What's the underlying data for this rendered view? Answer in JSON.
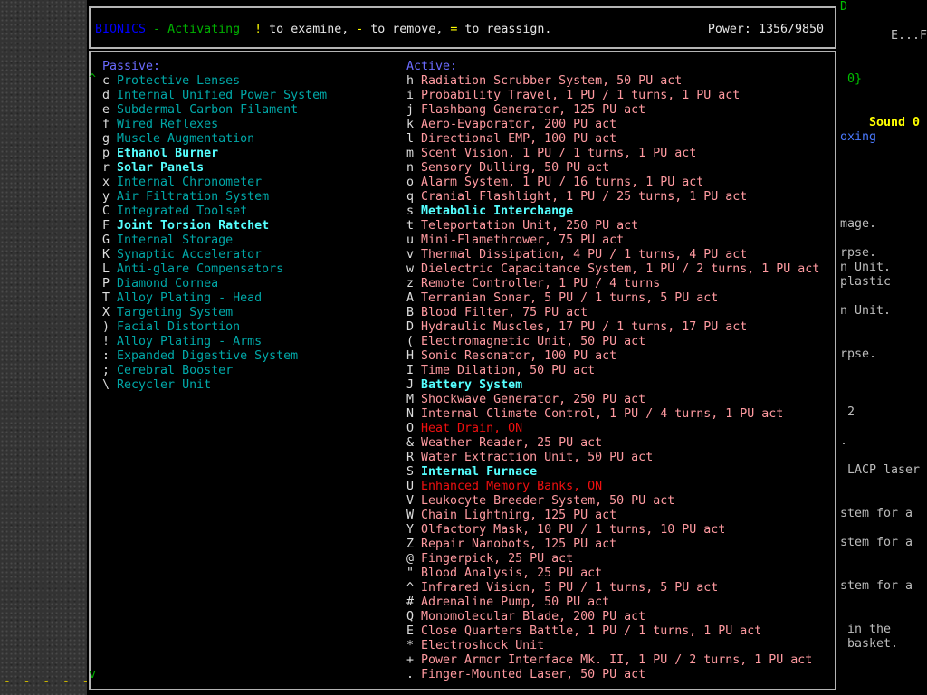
{
  "header": {
    "title": "BIONICS",
    "sep": " - ",
    "mode": "Activating",
    "k_examine": "!",
    "t_examine": " to examine, ",
    "k_remove": "-",
    "t_remove": " to remove, ",
    "k_reassign": "=",
    "t_reassign": " to reassign.",
    "power": "Power: 1356/9850"
  },
  "scroll": {
    "up": "^",
    "down": "v"
  },
  "passive": {
    "heading": "Passive:",
    "items": [
      {
        "key": "c",
        "name": "Protective Lenses",
        "hi": false
      },
      {
        "key": "d",
        "name": "Internal Unified Power System",
        "hi": false
      },
      {
        "key": "e",
        "name": "Subdermal Carbon Filament",
        "hi": false
      },
      {
        "key": "f",
        "name": "Wired Reflexes",
        "hi": false
      },
      {
        "key": "g",
        "name": "Muscle Augmentation",
        "hi": false
      },
      {
        "key": "p",
        "name": "Ethanol Burner",
        "hi": true
      },
      {
        "key": "r",
        "name": "Solar Panels",
        "hi": true
      },
      {
        "key": "x",
        "name": "Internal Chronometer",
        "hi": false
      },
      {
        "key": "y",
        "name": "Air Filtration System",
        "hi": false
      },
      {
        "key": "C",
        "name": "Integrated Toolset",
        "hi": false
      },
      {
        "key": "F",
        "name": "Joint Torsion Ratchet",
        "hi": true
      },
      {
        "key": "G",
        "name": "Internal Storage",
        "hi": false
      },
      {
        "key": "K",
        "name": "Synaptic Accelerator",
        "hi": false
      },
      {
        "key": "L",
        "name": "Anti-glare Compensators",
        "hi": false
      },
      {
        "key": "P",
        "name": "Diamond Cornea",
        "hi": false
      },
      {
        "key": "T",
        "name": "Alloy Plating - Head",
        "hi": false
      },
      {
        "key": "X",
        "name": "Targeting System",
        "hi": false
      },
      {
        "key": ")",
        "name": "Facial Distortion",
        "hi": false
      },
      {
        "key": "!",
        "name": "Alloy Plating - Arms",
        "hi": false
      },
      {
        "key": ":",
        "name": "Expanded Digestive System",
        "hi": false
      },
      {
        "key": ";",
        "name": "Cerebral Booster",
        "hi": false
      },
      {
        "key": "\\",
        "name": "Recycler Unit",
        "hi": false
      }
    ]
  },
  "active": {
    "heading": "Active:",
    "items": [
      {
        "key": "h",
        "name": "Radiation Scrubber System, 50 PU act",
        "state": "normal"
      },
      {
        "key": "i",
        "name": "Probability Travel, 1 PU / 1 turns, 1 PU act",
        "state": "normal"
      },
      {
        "key": "j",
        "name": "Flashbang Generator, 125 PU act",
        "state": "normal"
      },
      {
        "key": "k",
        "name": "Aero-Evaporator, 200 PU act",
        "state": "normal"
      },
      {
        "key": "l",
        "name": "Directional EMP, 100 PU act",
        "state": "normal"
      },
      {
        "key": "m",
        "name": "Scent Vision, 1 PU / 1 turns, 1 PU act",
        "state": "normal"
      },
      {
        "key": "n",
        "name": "Sensory Dulling, 50 PU act",
        "state": "normal"
      },
      {
        "key": "o",
        "name": "Alarm System, 1 PU / 16 turns, 1 PU act",
        "state": "normal"
      },
      {
        "key": "q",
        "name": "Cranial Flashlight, 1 PU / 25 turns, 1 PU act",
        "state": "normal"
      },
      {
        "key": "s",
        "name": "Metabolic Interchange",
        "state": "hi"
      },
      {
        "key": "t",
        "name": "Teleportation Unit, 250 PU act",
        "state": "normal"
      },
      {
        "key": "u",
        "name": "Mini-Flamethrower, 75 PU act",
        "state": "normal"
      },
      {
        "key": "v",
        "name": "Thermal Dissipation, 4 PU / 1 turns, 4 PU act",
        "state": "normal"
      },
      {
        "key": "w",
        "name": "Dielectric Capacitance System, 1 PU / 2 turns, 1 PU act",
        "state": "normal"
      },
      {
        "key": "z",
        "name": "Remote Controller, 1 PU / 4 turns",
        "state": "normal"
      },
      {
        "key": "A",
        "name": "Terranian Sonar, 5 PU / 1 turns, 5 PU act",
        "state": "normal"
      },
      {
        "key": "B",
        "name": "Blood Filter, 75 PU act",
        "state": "normal"
      },
      {
        "key": "D",
        "name": "Hydraulic Muscles, 17 PU / 1 turns, 17 PU act",
        "state": "normal"
      },
      {
        "key": "(",
        "name": "Electromagnetic Unit, 50 PU act",
        "state": "normal"
      },
      {
        "key": "H",
        "name": "Sonic Resonator, 100 PU act",
        "state": "normal"
      },
      {
        "key": "I",
        "name": "Time Dilation, 50 PU act",
        "state": "normal"
      },
      {
        "key": "J",
        "name": "Battery System",
        "state": "hi"
      },
      {
        "key": "M",
        "name": "Shockwave Generator, 250 PU act",
        "state": "normal"
      },
      {
        "key": "N",
        "name": "Internal Climate Control, 1 PU / 4 turns, 1 PU act",
        "state": "normal"
      },
      {
        "key": "O",
        "name": "Heat Drain, ON",
        "state": "on"
      },
      {
        "key": "&",
        "name": "Weather Reader, 25 PU act",
        "state": "normal"
      },
      {
        "key": "R",
        "name": "Water Extraction Unit, 50 PU act",
        "state": "normal"
      },
      {
        "key": "S",
        "name": "Internal Furnace",
        "state": "hi"
      },
      {
        "key": "U",
        "name": "Enhanced Memory Banks, ON",
        "state": "on"
      },
      {
        "key": "V",
        "name": "Leukocyte Breeder System, 50 PU act",
        "state": "normal"
      },
      {
        "key": "W",
        "name": "Chain Lightning, 125 PU act",
        "state": "normal"
      },
      {
        "key": "Y",
        "name": "Olfactory Mask, 10 PU / 1 turns, 10 PU act",
        "state": "normal"
      },
      {
        "key": "Z",
        "name": "Repair Nanobots, 125 PU act",
        "state": "normal"
      },
      {
        "key": "@",
        "name": "Fingerpick, 25 PU act",
        "state": "normal"
      },
      {
        "key": "\"",
        "name": "Blood Analysis, 25 PU act",
        "state": "normal"
      },
      {
        "key": "^",
        "name": "Infrared Vision, 5 PU / 1 turns, 5 PU act",
        "state": "normal"
      },
      {
        "key": "#",
        "name": "Adrenaline Pump, 50 PU act",
        "state": "normal"
      },
      {
        "key": "Q",
        "name": "Monomolecular Blade, 200 PU act",
        "state": "normal"
      },
      {
        "key": "E",
        "name": "Close Quarters Battle, 1 PU / 1 turns, 1 PU act",
        "state": "normal"
      },
      {
        "key": "*",
        "name": "Electroshock Unit",
        "state": "normal"
      },
      {
        "key": "+",
        "name": "Power Armor Interface Mk. II, 1 PU / 2 turns, 1 PU act",
        "state": "normal"
      },
      {
        "key": ".",
        "name": "Finger-Mounted Laser, 50 PU act",
        "state": "normal"
      }
    ]
  },
  "background": {
    "left_dashes": "- - - - -",
    "fragments": [
      {
        "text": "D",
        "color": "#00c000"
      },
      {
        "text": "E...F",
        "color": "#c0c0c0"
      },
      {
        "text": "0}",
        "color": "#00c000"
      },
      {
        "text": "Sound 0",
        "color": "#ffff00"
      },
      {
        "text": "oxing",
        "color": "#4a7aff"
      },
      {
        "text": "mage.",
        "color": "#bcbcbc"
      },
      {
        "text": "rpse.",
        "color": "#bcbcbc"
      },
      {
        "text": "n Unit.",
        "color": "#bcbcbc"
      },
      {
        "text": "plastic",
        "color": "#bcbcbc"
      },
      {
        "text": "n Unit.",
        "color": "#bcbcbc"
      },
      {
        "text": "rpse.",
        "color": "#bcbcbc"
      },
      {
        "text": "2",
        "color": "#bcbcbc"
      },
      {
        "text": ".",
        "color": "#bcbcbc"
      },
      {
        "text": "LACP laser",
        "color": "#bcbcbc"
      },
      {
        "text": "stem for a",
        "color": "#bcbcbc"
      },
      {
        "text": "stem for a",
        "color": "#bcbcbc"
      },
      {
        "text": "stem for a",
        "color": "#bcbcbc"
      },
      {
        "text": "in the",
        "color": "#bcbcbc"
      },
      {
        "text": "basket.",
        "color": "#bcbcbc"
      }
    ]
  }
}
